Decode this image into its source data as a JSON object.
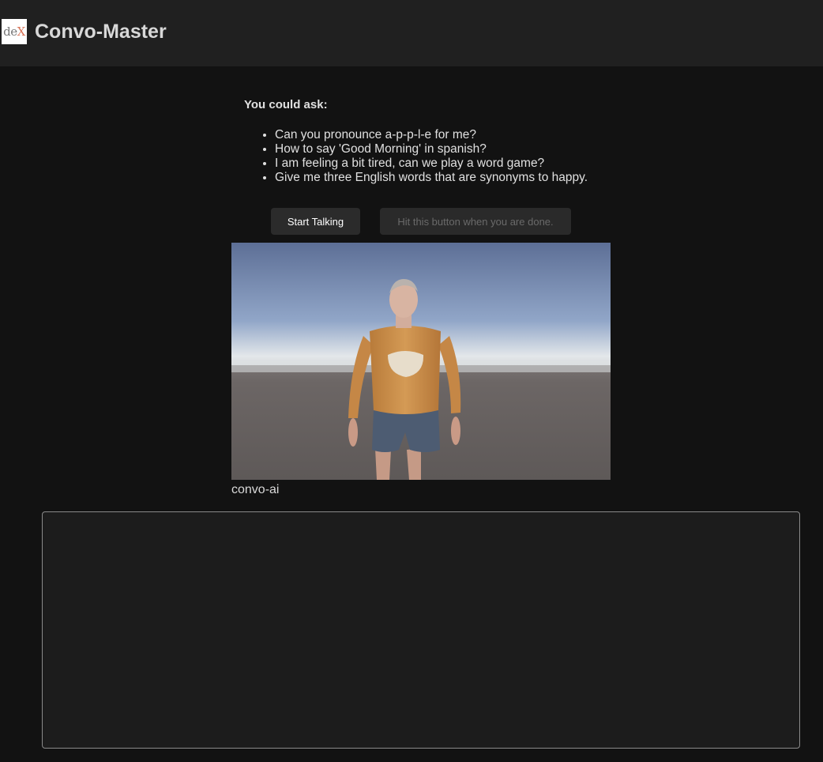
{
  "header": {
    "logo_text_part1": "de",
    "logo_text_part2": "X",
    "title": "Convo-Master"
  },
  "suggestions": {
    "heading": "You could ask:",
    "items": [
      "Can you pronounce a-p-p-l-e for me?",
      "How to say 'Good Morning' in spanish?",
      "I am feeling a bit tired, can we play a word game?",
      "Give me three English words that are synonyms to happy."
    ]
  },
  "controls": {
    "start_label": "Start Talking",
    "done_label": "Hit this button when you are done."
  },
  "avatar": {
    "caption": "convo-ai"
  },
  "transcript": {
    "value": ""
  },
  "colors": {
    "page_background": "#121212",
    "header_background": "#202020",
    "accent_logo_x": "#d9765a"
  }
}
